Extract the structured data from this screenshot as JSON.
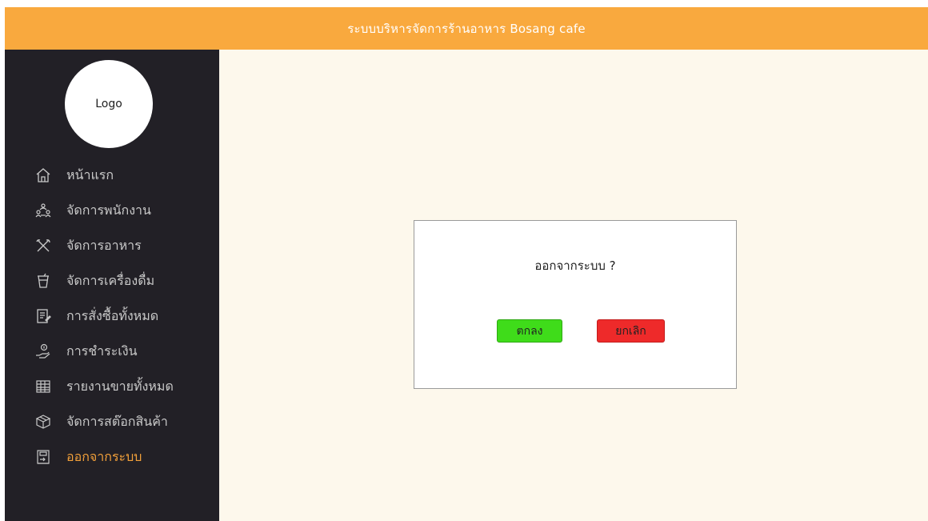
{
  "header": {
    "title": "ระบบบริหารจัดการร้านอาหาร Bosang cafe",
    "bg_color": "#f9a93e"
  },
  "sidebar": {
    "logo_text": "Logo",
    "bg_color": "#222026",
    "items": [
      {
        "label": "หน้าแรก",
        "icon": "home-icon",
        "active": false
      },
      {
        "label": "จัดการพนักงาน",
        "icon": "employees-icon",
        "active": false
      },
      {
        "label": "จัดการอาหาร",
        "icon": "utensils-icon",
        "active": false
      },
      {
        "label": "จัดการเครื่องดื่ม",
        "icon": "drink-icon",
        "active": false
      },
      {
        "label": "การสั่งซื้อทั้งหมด",
        "icon": "orders-icon",
        "active": false
      },
      {
        "label": "การชำระเงิน",
        "icon": "payment-icon",
        "active": false
      },
      {
        "label": "รายงานขายทั้งหมด",
        "icon": "report-icon",
        "active": false
      },
      {
        "label": "จัดการสต๊อกสินค้า",
        "icon": "stock-box-icon",
        "active": false
      },
      {
        "label": "ออกจากระบบ",
        "icon": "exit-icon",
        "active": true
      }
    ],
    "active_color": "#f2a03a"
  },
  "dialog": {
    "title": "ออกจากระบบ ?",
    "ok_label": "ตกลง",
    "cancel_label": "ยกเลิก",
    "ok_color": "#3fdc1a",
    "cancel_color": "#ee2a2a"
  }
}
